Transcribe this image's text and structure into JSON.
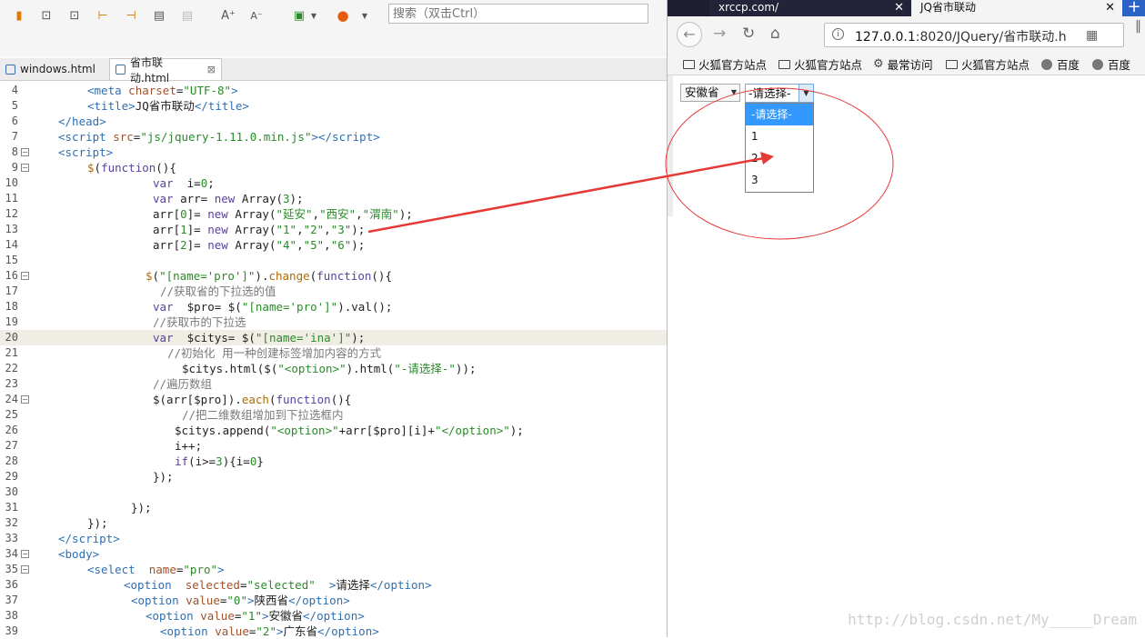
{
  "ide": {
    "search_placeholder": "搜索（双击Ctrl）",
    "tabs": [
      {
        "label": "windows.html",
        "active": false
      },
      {
        "label": "省市联动.html",
        "active": true
      }
    ]
  },
  "code_lines": [
    {
      "n": "4",
      "indent": 96,
      "html": "<span class=\"t-tag\">&lt;meta</span> <span class=\"t-attr\">charset</span>=<span class=\"t-str\">\"UTF-8\"</span><span class=\"t-tag\">&gt;</span>"
    },
    {
      "n": "5",
      "indent": 96,
      "html": "<span class=\"t-tag\">&lt;title&gt;</span>JQ省市联动<span class=\"t-tag\">&lt;/title&gt;</span>"
    },
    {
      "n": "6",
      "indent": 64,
      "html": "<span class=\"t-tag\">&lt;/head&gt;</span>"
    },
    {
      "n": "7",
      "indent": 64,
      "html": "<span class=\"t-tag\">&lt;script</span> <span class=\"t-attr\">src</span>=<span class=\"t-str\">\"js/jquery-1.11.0.min.js\"</span><span class=\"t-tag\">&gt;&lt;/script&gt;</span>"
    },
    {
      "n": "8",
      "indent": 64,
      "fold": true,
      "html": "<span class=\"t-tag\">&lt;script&gt;</span>"
    },
    {
      "n": "9",
      "indent": 96,
      "fold": true,
      "html": "<span class=\"t-fn\">$</span>(<span class=\"t-kw\">function</span>(){"
    },
    {
      "n": "10",
      "indent": 168,
      "html": "<span class=\"t-kw\">var</span>  i=<span class=\"t-str\">0</span>;"
    },
    {
      "n": "11",
      "indent": 168,
      "html": "<span class=\"t-kw\">var</span> arr= <span class=\"t-kw\">new</span> Array(<span class=\"t-str\">3</span>);"
    },
    {
      "n": "12",
      "indent": 168,
      "html": "arr[<span class=\"t-str\">0</span>]= <span class=\"t-kw\">new</span> Array(<span class=\"t-str\">\"延安\"</span>,<span class=\"t-str\">\"西安\"</span>,<span class=\"t-str\">\"渭南\"</span>);"
    },
    {
      "n": "13",
      "indent": 168,
      "html": "arr[<span class=\"t-str\">1</span>]= <span class=\"t-kw\">new</span> Array(<span class=\"t-str\">\"1\"</span>,<span class=\"t-str\">\"2\"</span>,<span class=\"t-str\">\"3\"</span>);"
    },
    {
      "n": "14",
      "indent": 168,
      "html": "arr[<span class=\"t-str\">2</span>]= <span class=\"t-kw\">new</span> Array(<span class=\"t-str\">\"4\"</span>,<span class=\"t-str\">\"5\"</span>,<span class=\"t-str\">\"6\"</span>);"
    },
    {
      "n": "15",
      "indent": 168,
      "html": ""
    },
    {
      "n": "16",
      "indent": 160,
      "fold": true,
      "html": "<span class=\"t-fn\">$</span>(<span class=\"t-str\">\"[name='pro']\"</span>).<span class=\"t-fn\">change</span>(<span class=\"t-kw\">function</span>(){"
    },
    {
      "n": "17",
      "indent": 176,
      "html": "<span class=\"t-com\">//获取省的下拉选的值</span>"
    },
    {
      "n": "18",
      "indent": 168,
      "html": "<span class=\"t-kw\">var</span>  $pro= $(<span class=\"t-str\">\"[name='pro']\"</span>).val();"
    },
    {
      "n": "19",
      "indent": 168,
      "html": "<span class=\"t-com\">//获取市的下拉选</span>"
    },
    {
      "n": "20",
      "indent": 168,
      "hl": true,
      "html": "<span class=\"t-kw\">var</span>  $citys= $(<span class=\"t-str\">\"[name='ina']\"</span>);"
    },
    {
      "n": "21",
      "indent": 184,
      "html": "<span class=\"t-com\">//初始化 用一种创建标签增加内容的方式</span>"
    },
    {
      "n": "22",
      "indent": 200,
      "html": "$citys.html($(<span class=\"t-str\">\"&lt;option&gt;\"</span>).html(<span class=\"t-str\">\"-请选择-\"</span>));"
    },
    {
      "n": "23",
      "indent": 168,
      "html": "<span class=\"t-com\">//遍历数组</span>"
    },
    {
      "n": "24",
      "indent": 168,
      "fold": true,
      "html": "$(arr[$pro]).<span class=\"t-fn\">each</span>(<span class=\"t-kw\">function</span>(){"
    },
    {
      "n": "25",
      "indent": 200,
      "html": "<span class=\"t-com\">//把二维数组增加到下拉选框内</span>"
    },
    {
      "n": "26",
      "indent": 192,
      "html": "$citys.append(<span class=\"t-str\">\"&lt;option&gt;\"</span>+arr[$pro][i]+<span class=\"t-str\">\"&lt;/option&gt;\"</span>);"
    },
    {
      "n": "27",
      "indent": 192,
      "html": "i++;"
    },
    {
      "n": "28",
      "indent": 192,
      "html": "<span class=\"t-kw\">if</span>(i&gt;=<span class=\"t-str\">3</span>){i=<span class=\"t-str\">0</span>}"
    },
    {
      "n": "29",
      "indent": 168,
      "html": "});"
    },
    {
      "n": "30",
      "indent": 168,
      "html": ""
    },
    {
      "n": "31",
      "indent": 144,
      "html": "});"
    },
    {
      "n": "32",
      "indent": 96,
      "html": "});"
    },
    {
      "n": "33",
      "indent": 64,
      "html": "<span class=\"t-tag\">&lt;/script&gt;</span>"
    },
    {
      "n": "34",
      "indent": 64,
      "fold": true,
      "html": "<span class=\"t-tag\">&lt;body&gt;</span>"
    },
    {
      "n": "35",
      "indent": 96,
      "fold": true,
      "html": "<span class=\"t-tag\">&lt;select</span>  <span class=\"t-attr\">name</span>=<span class=\"t-str\">\"pro\"</span><span class=\"t-tag\">&gt;</span>"
    },
    {
      "n": "36",
      "indent": 136,
      "html": "<span class=\"t-tag\">&lt;option</span>  <span class=\"t-attr\">selected</span>=<span class=\"t-str\">\"selected\"</span>  <span class=\"t-tag\">&gt;</span>请选择<span class=\"t-tag\">&lt;/option&gt;</span>"
    },
    {
      "n": "37",
      "indent": 144,
      "html": "<span class=\"t-tag\">&lt;option</span> <span class=\"t-attr\">value</span>=<span class=\"t-str\">\"0\"</span><span class=\"t-tag\">&gt;</span>陕西省<span class=\"t-tag\">&lt;/option&gt;</span>"
    },
    {
      "n": "38",
      "indent": 160,
      "html": "<span class=\"t-tag\">&lt;option</span> <span class=\"t-attr\">value</span>=<span class=\"t-str\">\"1\"</span><span class=\"t-tag\">&gt;</span>安徽省<span class=\"t-tag\">&lt;/option&gt;</span>"
    },
    {
      "n": "39",
      "indent": 176,
      "html": "<span class=\"t-tag\">&lt;option</span> <span class=\"t-attr\">value</span>=<span class=\"t-str\">\"2\"</span><span class=\"t-tag\">&gt;</span>广东省<span class=\"t-tag\">&lt;/option&gt;</span>"
    }
  ],
  "browser": {
    "tabs": [
      {
        "label": "xrccp.com/",
        "active": false
      },
      {
        "label": "JQ省市联动",
        "active": true
      }
    ],
    "new_tab": "+",
    "url": {
      "host": "127.0.0.1",
      "rest": ":8020/JQuery/省市联动.h"
    },
    "bookmarks": [
      {
        "label": "火狐官方站点",
        "icon": "folder-icon"
      },
      {
        "label": "火狐官方站点",
        "icon": "folder-icon"
      },
      {
        "label": "最常访问",
        "icon": "gear-icon"
      },
      {
        "label": "火狐官方站点",
        "icon": "folder-icon"
      },
      {
        "label": "百度",
        "icon": "globe-icon"
      },
      {
        "label": "百度",
        "icon": "globe-icon"
      }
    ],
    "page": {
      "province_value": "安徽省",
      "city_value": "-请选择-",
      "city_options": [
        "-请选择-",
        "1",
        "2",
        "3"
      ]
    }
  },
  "watermark": "http://blog.csdn.net/My_____Dream",
  "annotation_color": "#e53935"
}
